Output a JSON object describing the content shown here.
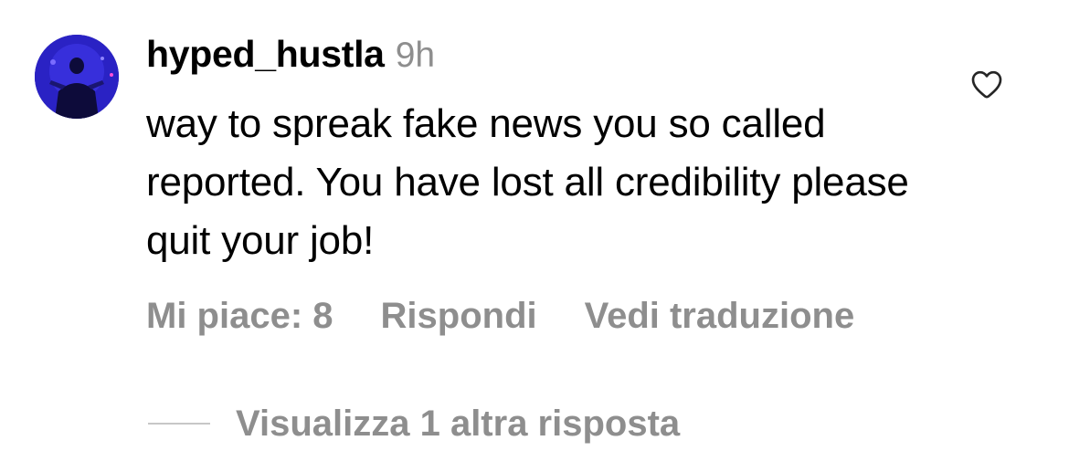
{
  "comment": {
    "username": "hyped_hustla",
    "timestamp": "9h",
    "text": "way to spreak fake news you so called reported. You have lost all credibility please quit your job!",
    "avatar_icon": "profile-avatar",
    "like_icon": "heart-outline-icon"
  },
  "actions": {
    "likes": "Mi piace: 8",
    "reply": "Rispondi",
    "translate": "Vedi traduzione"
  },
  "replies": {
    "view_more": "Visualizza 1 altra risposta"
  },
  "colors": {
    "primary_text": "#000000",
    "secondary_text": "#8e8e8e",
    "divider": "#c7c7c7",
    "avatar_bg": "#1e1aa8"
  }
}
